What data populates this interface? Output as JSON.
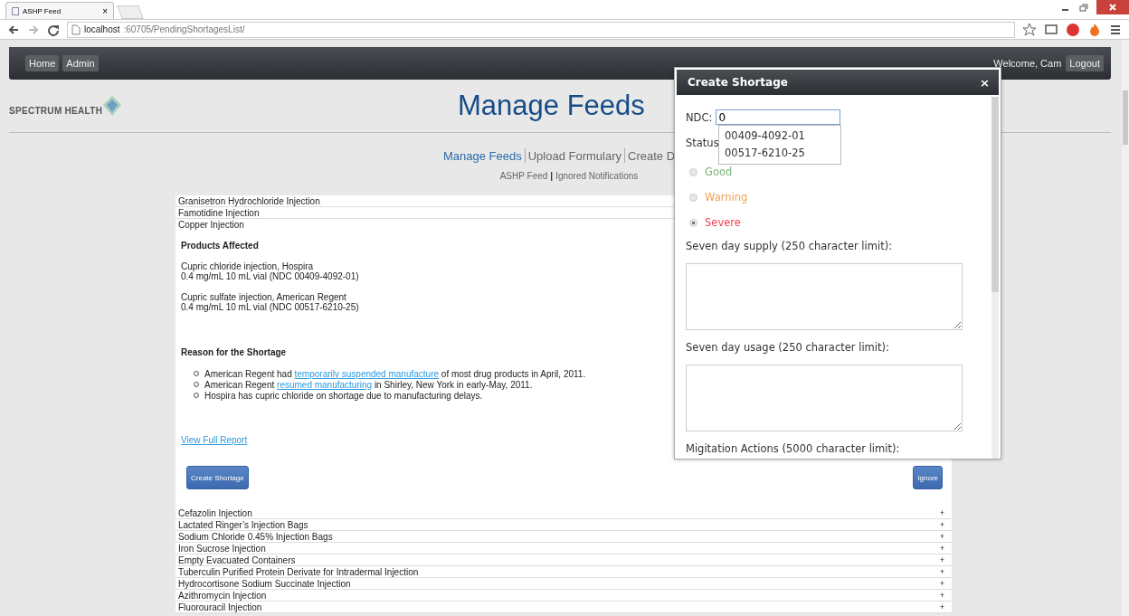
{
  "browser": {
    "tab_title": "ASHP Feed",
    "tab_close": "×",
    "url_host": "localhost",
    "url_path": ":60705/PendingShortagesList/"
  },
  "navbar": {
    "buttons": [
      "Home",
      "Admin"
    ],
    "welcome": "Welcome, Cam",
    "logout": "Logout"
  },
  "header": {
    "logo": "SPECTRUM HEALTH",
    "title": "Manage Feeds"
  },
  "nav_links": [
    {
      "label": "Manage Feeds",
      "selected": true
    },
    {
      "label": "Upload Formulary",
      "selected": false
    },
    {
      "label": "Create D",
      "selected": false
    }
  ],
  "sub_links": {
    "items": [
      "ASHP Feed",
      "Ignored Notifications"
    ],
    "separator": "|"
  },
  "feed_items_top": [
    {
      "name": "Granisetron Hydrochloride Injection",
      "expanded": false
    },
    {
      "name": "Famotidine Injection",
      "expanded": false
    },
    {
      "name": "Copper Injection",
      "expanded": true
    }
  ],
  "detail": {
    "products_heading": "Products Affected",
    "products": [
      [
        "Cupric chloride injection, Hospira",
        "0.4 mg/mL 10 mL vial (NDC 00409-4092-01)"
      ],
      [
        "Cupric sulfate injection, American Regent",
        "0.4 mg/mL 10 mL vial (NDC 00517-6210-25)"
      ]
    ],
    "reason_heading": "Reason for the Shortage",
    "reasons": [
      [
        {
          "kind": "text",
          "text": "American Regent had "
        },
        {
          "kind": "link",
          "text": "temporarily suspended manufacture"
        },
        {
          "kind": "text",
          "text": " of most drug products in April, 2011."
        }
      ],
      [
        {
          "kind": "text",
          "text": "American Regent "
        },
        {
          "kind": "link",
          "text": "resumed manufacturing"
        },
        {
          "kind": "text",
          "text": " in Shirley, New York in early-May, 2011."
        }
      ],
      [
        {
          "kind": "text",
          "text": "Hospira has cupric chloride on shortage due to manufacturing delays."
        }
      ]
    ],
    "report_link": "View Full Report",
    "create_button": "Create Shortage",
    "ignore_button": "Ignore"
  },
  "feed_items": [
    {
      "name": "Cefazolin Injection",
      "toggle": "+"
    },
    {
      "name": "Lactated Ringer’s Injection Bags",
      "toggle": "+"
    },
    {
      "name": "Sodium Chloride 0.45% Injection Bags",
      "toggle": "+"
    },
    {
      "name": "Iron Sucrose Injection",
      "toggle": "+"
    },
    {
      "name": "Empty Evacuated Containers",
      "toggle": "+"
    },
    {
      "name": "Tuberculin Purified Protein Derivate for Intradermal Injection",
      "toggle": "+"
    },
    {
      "name": "Hydrocortisone Sodium Succinate Injection",
      "toggle": "+"
    },
    {
      "name": "Azithromycin Injection",
      "toggle": "+"
    },
    {
      "name": "Fluorouracil Injection",
      "toggle": "+"
    }
  ],
  "modal": {
    "title": "Create Shortage",
    "close": "×",
    "ndc_label": "NDC:",
    "ndc_value": "0",
    "suggestions": [
      "00409-4092-01",
      "00517-6210-25"
    ],
    "status_label": "Status",
    "statuses": [
      {
        "label": "Good",
        "color": "#7ab87a",
        "selected": false
      },
      {
        "label": "Warning",
        "color": "#f0a050",
        "selected": false
      },
      {
        "label": "Severe",
        "color": "#f04050",
        "selected": true
      }
    ],
    "fields": [
      {
        "label": "Seven day supply (250 character limit):",
        "kind": "textarea"
      },
      {
        "label": "Seven day usage (250 character limit):",
        "kind": "textarea"
      },
      {
        "label": "Migitation Actions (5000 character limit):",
        "kind": "label"
      }
    ]
  }
}
